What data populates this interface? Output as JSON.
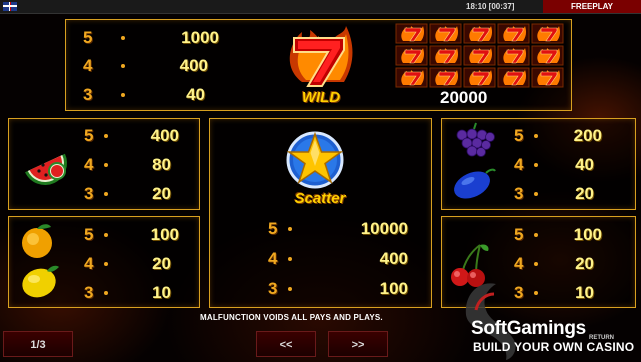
{
  "topbar": {
    "clock": "18:10 [00:37]",
    "mode": "FREEPLAY"
  },
  "wild": {
    "label": "WILD",
    "pays": [
      {
        "count": "5",
        "value": "1000"
      },
      {
        "count": "4",
        "value": "400"
      },
      {
        "count": "3",
        "value": "40"
      }
    ],
    "full_screen_value": "20000"
  },
  "scatter": {
    "label": "Scatter",
    "pays": [
      {
        "count": "5",
        "value": "10000"
      },
      {
        "count": "4",
        "value": "400"
      },
      {
        "count": "3",
        "value": "100"
      }
    ]
  },
  "watermelon": {
    "pays": [
      {
        "count": "5",
        "value": "400"
      },
      {
        "count": "4",
        "value": "80"
      },
      {
        "count": "3",
        "value": "20"
      }
    ]
  },
  "grapes_plum": {
    "pays": [
      {
        "count": "5",
        "value": "200"
      },
      {
        "count": "4",
        "value": "40"
      },
      {
        "count": "3",
        "value": "20"
      }
    ]
  },
  "orange_lemon": {
    "pays": [
      {
        "count": "5",
        "value": "100"
      },
      {
        "count": "4",
        "value": "20"
      },
      {
        "count": "3",
        "value": "10"
      }
    ]
  },
  "cherry": {
    "pays": [
      {
        "count": "5",
        "value": "100"
      },
      {
        "count": "4",
        "value": "20"
      },
      {
        "count": "3",
        "value": "10"
      }
    ]
  },
  "footer": {
    "page": "1/3",
    "prev": "<<",
    "next": ">>",
    "malfunction": "MALFUNCTION VOIDS ALL PAYS AND PLAYS."
  },
  "watermark": {
    "name": "SoftGamings",
    "tagline": "BUILD YOUR OWN CASINO",
    "return": "RETURN"
  },
  "colors": {
    "panel_border": "#d8a020",
    "count": "#f0a820",
    "value": "#fff38a",
    "button": "#3a0000"
  }
}
